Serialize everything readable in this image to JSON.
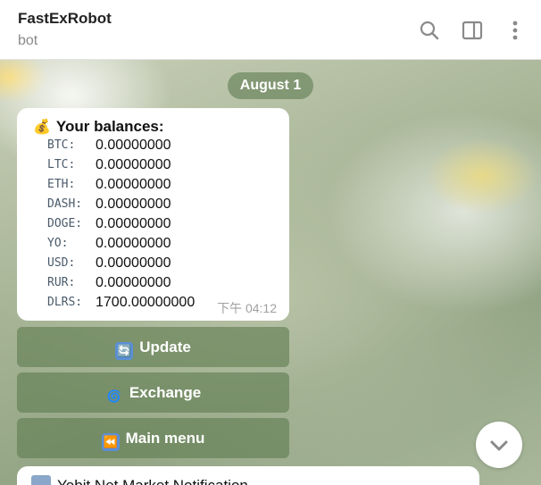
{
  "header": {
    "title": "FastExRobot",
    "subtitle": "bot",
    "icons": [
      "search-icon",
      "sidebar-toggle-icon",
      "more-vertical-icon"
    ]
  },
  "chat": {
    "date_pill": "August 1",
    "balance_message": {
      "emoji": "💰",
      "heading": "Your balances:",
      "rows": [
        {
          "currency": "BTC:",
          "value": "0.00000000"
        },
        {
          "currency": "LTC:",
          "value": "0.00000000"
        },
        {
          "currency": "ETH:",
          "value": "0.00000000"
        },
        {
          "currency": "DASH:",
          "value": "0.00000000"
        },
        {
          "currency": "DOGE:",
          "value": "0.00000000"
        },
        {
          "currency": "YO:",
          "value": "0.00000000"
        },
        {
          "currency": "USD:",
          "value": "0.00000000"
        },
        {
          "currency": "RUR:",
          "value": "0.00000000"
        },
        {
          "currency": "DLRS:",
          "value": "1700.00000000"
        }
      ],
      "time": "下午 04:12"
    },
    "keyboard": [
      {
        "label": "Update",
        "icon": "refresh-icon",
        "emoji": "🔄"
      },
      {
        "label": "Exchange",
        "icon": "cyclone-icon",
        "emoji": "🌀"
      },
      {
        "label": "Main menu",
        "icon": "rewind-icon",
        "emoji": "⏪"
      }
    ],
    "next_message": {
      "text": "Yobit Net Market Notification"
    }
  },
  "colors": {
    "keyboard_button": "#5f7d50",
    "date_pill": "#6e875f"
  }
}
